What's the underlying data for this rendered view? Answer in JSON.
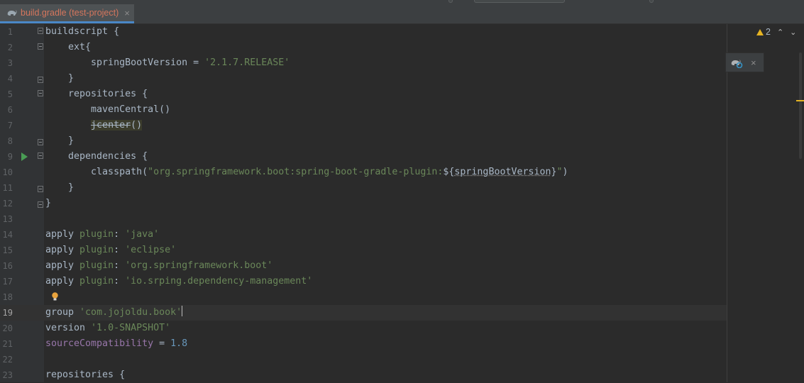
{
  "tab": {
    "title": "build.gradle (test-project)",
    "close": "×",
    "icon": "gradle-elephant-icon"
  },
  "warnings": {
    "count": "2",
    "up": "⌃",
    "down": "⌄"
  },
  "popup": {
    "icon": "gradle-reload-icon",
    "close": "×"
  },
  "colors": {
    "background": "#2b2b2b",
    "string": "#6a8759",
    "keyword": "#9876aa",
    "number": "#6897bb",
    "text": "#a9b7c6",
    "tab_text": "#d5765d"
  },
  "lines": [
    {
      "n": "1",
      "parts": [
        {
          "t": "buildscript {"
        }
      ]
    },
    {
      "n": "2",
      "parts": [
        {
          "t": "    ext{"
        }
      ]
    },
    {
      "n": "3",
      "parts": [
        {
          "t": "        springBootVersion = "
        },
        {
          "t": "'2.1.7.RELEASE'",
          "c": "str"
        }
      ]
    },
    {
      "n": "4",
      "parts": [
        {
          "t": "    }"
        }
      ]
    },
    {
      "n": "5",
      "parts": [
        {
          "t": "    repositories {"
        }
      ]
    },
    {
      "n": "6",
      "parts": [
        {
          "t": "        mavenCentral()"
        }
      ]
    },
    {
      "n": "7",
      "parts": [
        {
          "t": "        "
        },
        {
          "t": "jcenter",
          "c": "strike"
        },
        {
          "t": "()",
          "c": "hl"
        }
      ]
    },
    {
      "n": "8",
      "parts": [
        {
          "t": "    }"
        }
      ]
    },
    {
      "n": "9",
      "parts": [
        {
          "t": "    dependencies {"
        }
      ]
    },
    {
      "n": "10",
      "parts": [
        {
          "t": "        classpath("
        },
        {
          "t": "\"org.springframework.boot:spring-boot-gradle-plugin:",
          "c": "str"
        },
        {
          "t": "${"
        },
        {
          "t": "springBootVersion",
          "c": "dotted"
        },
        {
          "t": "}"
        },
        {
          "t": "\"",
          "c": "str"
        },
        {
          "t": ")"
        }
      ]
    },
    {
      "n": "11",
      "parts": [
        {
          "t": "    }"
        }
      ]
    },
    {
      "n": "12",
      "parts": [
        {
          "t": "}"
        }
      ]
    },
    {
      "n": "13",
      "parts": []
    },
    {
      "n": "14",
      "parts": [
        {
          "t": "apply "
        },
        {
          "t": "plugin",
          "c": "str"
        },
        {
          "t": ": "
        },
        {
          "t": "'java'",
          "c": "str"
        }
      ]
    },
    {
      "n": "15",
      "parts": [
        {
          "t": "apply "
        },
        {
          "t": "plugin",
          "c": "str"
        },
        {
          "t": ": "
        },
        {
          "t": "'eclipse'",
          "c": "str"
        }
      ]
    },
    {
      "n": "16",
      "parts": [
        {
          "t": "apply "
        },
        {
          "t": "plugin",
          "c": "str"
        },
        {
          "t": ": "
        },
        {
          "t": "'org.springframework.boot'",
          "c": "str"
        }
      ]
    },
    {
      "n": "17",
      "parts": [
        {
          "t": "apply "
        },
        {
          "t": "plugin",
          "c": "str"
        },
        {
          "t": ": "
        },
        {
          "t": "'io.srping.dependency-management'",
          "c": "str"
        }
      ]
    },
    {
      "n": "18",
      "parts": []
    },
    {
      "n": "19",
      "parts": [
        {
          "t": "group "
        },
        {
          "t": "'com.jojoldu.book'",
          "c": "str"
        }
      ]
    },
    {
      "n": "20",
      "parts": [
        {
          "t": "version "
        },
        {
          "t": "'1.0-SNAPSHOT'",
          "c": "str"
        }
      ]
    },
    {
      "n": "21",
      "parts": [
        {
          "t": "sourceCompatibility",
          "c": "kw"
        },
        {
          "t": " = "
        },
        {
          "t": "1.8",
          "c": "num"
        }
      ]
    },
    {
      "n": "22",
      "parts": []
    },
    {
      "n": "23",
      "parts": [
        {
          "t": "repositories {"
        }
      ]
    }
  ]
}
